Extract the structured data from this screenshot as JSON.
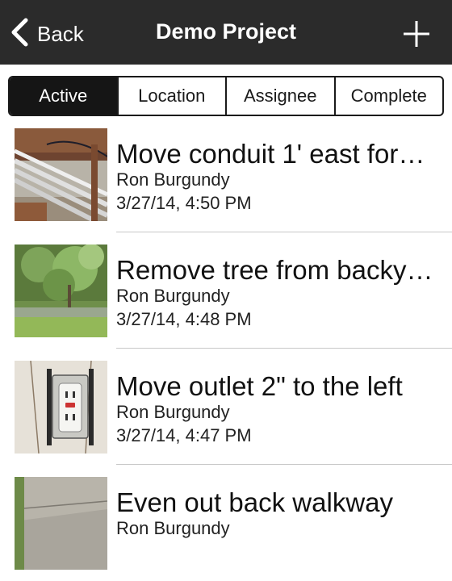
{
  "navbar": {
    "back_label": "Back",
    "title": "Demo Project",
    "add_icon": "plus-icon",
    "back_icon": "chevron-left-icon",
    "background": "#2b2b2b"
  },
  "filter_tabs": {
    "selected": "Active",
    "tabs": [
      {
        "label": "Active"
      },
      {
        "label": "Location"
      },
      {
        "label": "Assignee"
      },
      {
        "label": "Complete"
      }
    ]
  },
  "items": [
    {
      "title": "Move conduit 1' east for…",
      "assignee": "Ron Burgundy",
      "date": "3/27/14, 4:50 PM",
      "thumbnail": "conduit-photo"
    },
    {
      "title": "Remove tree from backy…",
      "assignee": "Ron Burgundy",
      "date": "3/27/14, 4:48 PM",
      "thumbnail": "tree-photo"
    },
    {
      "title": "Move outlet 2\" to the left",
      "assignee": "Ron Burgundy",
      "date": "3/27/14, 4:47 PM",
      "thumbnail": "outlet-photo"
    },
    {
      "title": "Even out back walkway",
      "assignee": "Ron Burgundy",
      "date": "",
      "thumbnail": "walkway-photo"
    }
  ]
}
